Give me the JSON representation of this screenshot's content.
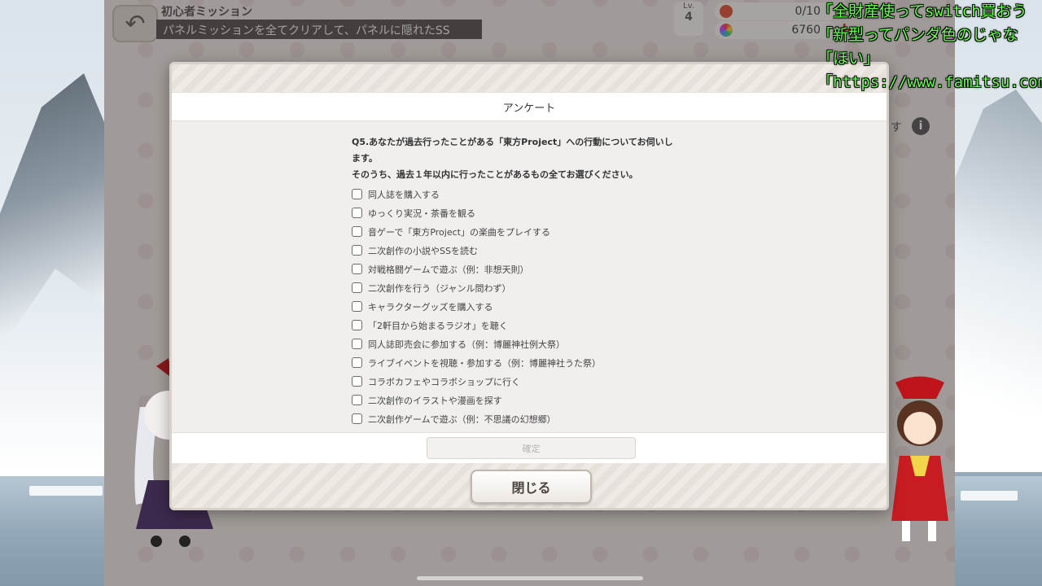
{
  "header": {
    "back_icon": "back-arrow-icon",
    "mission_title": "初心者ミッション",
    "mission_desc": "パネルミッションを全てクリアして、パネルに隠れたSS"
  },
  "status": {
    "level_label": "Lv.",
    "level": "4",
    "stamina": "0/10",
    "currency": "6760",
    "plus": "+",
    "side_fragment": "す",
    "info_label": "i"
  },
  "modal": {
    "title": "アンケート",
    "question": [
      "Q5.あなたが過去行ったことがある「東方Project」への行動についてお伺いし",
      "ます。",
      "そのうち、過去１年以内に行ったことがあるもの全てお選びください。"
    ],
    "options": [
      "同人誌を購入する",
      "ゆっくり実況・茶番を観る",
      "音ゲーで「東方Project」の楽曲をプレイする",
      "二次創作の小説やSSを読む",
      "対戦格闘ゲームで遊ぶ（例：非想天則）",
      "二次創作を行う（ジャンル問わず）",
      "キャラクターグッズを購入する",
      "「2軒目から始まるラジオ」を聴く",
      "同人誌即売会に参加する（例：博麗神社例大祭）",
      "ライブイベントを視聴・参加する（例：博麗神社うた祭）",
      "コラボカフェやコラボショップに行く",
      "二次創作のイラストや漫画を探す",
      "二次創作ゲームで遊ぶ（例：不思議の幻想郷）"
    ],
    "confirm_label": "確定",
    "close_label": "閉じる"
  },
  "comments": [
    {
      "text": "「全財産使ってswitch買おう",
      "color": "#6bff55"
    },
    {
      "text": "「新型ってパンダ色のじゃな",
      "color": "#6bff55"
    },
    {
      "text": "「ほい」",
      "color": "#6bff55"
    },
    {
      "text": "「https://www.famitsu.com/",
      "color": "#6bff55"
    }
  ],
  "colors": {
    "accent_red": "#d02020",
    "comment_green": "#6bff55"
  }
}
